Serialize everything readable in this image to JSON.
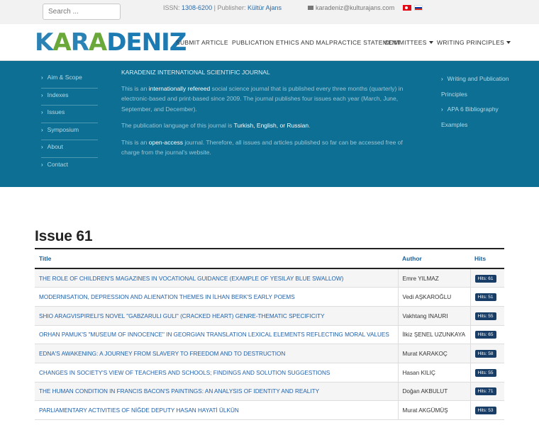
{
  "topbar": {
    "search_placeholder": "Search ...",
    "issn_label": "ISSN:",
    "issn_value": "1308-6200",
    "separator": "|",
    "publisher_label": "Publisher:",
    "publisher_value": "Kültür Ajans",
    "email": "karadeniz@kulturajans.com",
    "languages": [
      "tr",
      "ru"
    ]
  },
  "header": {
    "logo_text": "KARADENIZ",
    "nav": [
      {
        "label": "SUBMIT ARTICLE",
        "dropdown": false
      },
      {
        "label": "PUBLICATION ETHICS AND MALPRACTICE STATEMENT",
        "dropdown": false
      },
      {
        "label": "COMMITTEES",
        "dropdown": true
      },
      {
        "label": "WRITING PRINCIPLES",
        "dropdown": true
      }
    ]
  },
  "footer_band": {
    "left_nav": [
      "Aim & Scope",
      "Indexes",
      "Issues",
      "Symposium",
      "About",
      "Contact"
    ],
    "about_heading": "KARADENIZ INTERNATIONAL SCIENTIFIC JOURNAL",
    "p1_pre": "This is an ",
    "p1_hl": "internationally refereed",
    "p1_post": " social science journal that is published every three months (quarterly) in electronic-based and print-based since 2009. The journal publishes four issues each year (March, June, September, and December).",
    "p2_pre": "The publication language of this journal is ",
    "p2_hl": "Turkish, English, or Russian",
    "p2_post": ".",
    "p3_pre": "This is an ",
    "p3_hl": "open-access",
    "p3_post": " journal. Therefore, all issues and articles published so far can be accessed free of charge from the journal's website.",
    "right_nav": [
      "Writing and Publication Principles",
      "APA 6 Bibliography Examples"
    ]
  },
  "issue": {
    "title": "Issue 61",
    "columns": [
      "Title",
      "Author",
      "Hits"
    ],
    "rows": [
      {
        "title": "THE ROLE OF CHILDREN'S MAGAZINES IN VOCATIONAL GUIDANCE (EXAMPLE OF YESILAY BLUE SWALLOW)",
        "author": "Emre YILMAZ",
        "hits": "Hits: 61"
      },
      {
        "title": "MODERNISATION, DEPRESSION AND ALIENATION THEMES IN İLHAN BERK'S EARLY POEMS",
        "author": "Vedi AŞKAROĞLU",
        "hits": "Hits: 51"
      },
      {
        "title": "SHIO ARAGVISPIRELI'S NOVEL \"GABZARULI GULI\" (CRACKED HEART) GENRE-THEMATIC SPECIFICITY",
        "author": "Vakhtang INAURI",
        "hits": "Hits: 55"
      },
      {
        "title": "ORHAN PAMUK'S \"MUSEUM OF INNOCENCE\" IN GEORGIAN TRANSLATION LEXICAL ELEMENTS REFLECTING MORAL VALUES",
        "author": "İlkiz ŞENEL UZUNKAYA",
        "hits": "Hits: 65"
      },
      {
        "title": "EDNA'S AWAKENING: A JOURNEY FROM SLAVERY TO FREEDOM AND TO DESTRUCTION",
        "author": "Murat KARAKOÇ",
        "hits": "Hits: 58"
      },
      {
        "title": "CHANGES IN SOCIETY'S VIEW OF TEACHERS AND SCHOOLS; FINDINGS AND SOLUTION SUGGESTIONS",
        "author": "Hasan KILIÇ",
        "hits": "Hits: 55"
      },
      {
        "title": "THE HUMAN CONDITION IN FRANCIS BACON'S PAINTINGS: AN ANALYSIS OF IDENTITY AND REALITY",
        "author": "Doğan AKBULUT",
        "hits": "Hits: 71"
      },
      {
        "title": "PARLIAMENTARY ACTIVITIES OF NİĞDE DEPUTY HASAN HAYATİ ÜLKÜN",
        "author": "Murat AKGÜMÜŞ",
        "hits": "Hits: 53"
      }
    ]
  }
}
